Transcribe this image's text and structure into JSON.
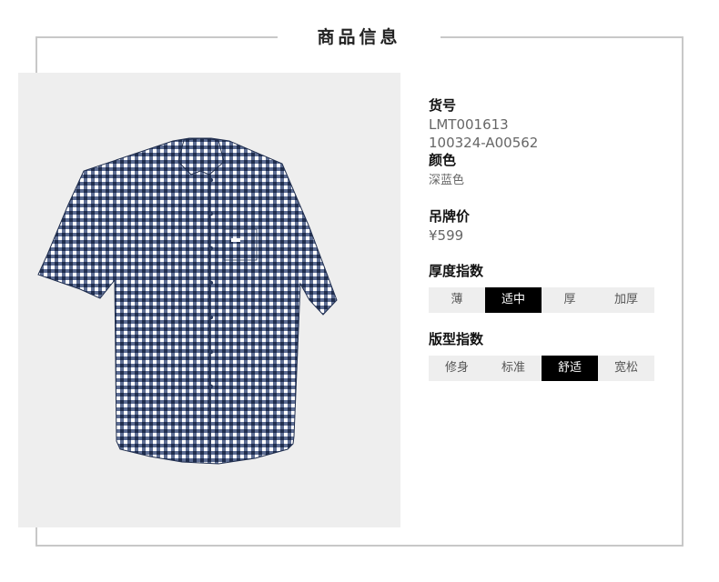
{
  "section_title": "商品信息",
  "product": {
    "sku_label": "货号",
    "sku_values": [
      "LMT001613",
      "100324-A00562"
    ],
    "color_label": "颜色",
    "color_value": "深蓝色",
    "price_label": "吊牌价",
    "price_value": "¥599",
    "thickness": {
      "label": "厚度指数",
      "options": [
        "薄",
        "适中",
        "厚",
        "加厚"
      ],
      "selected": "适中"
    },
    "fit": {
      "label": "版型指数",
      "options": [
        "修身",
        "标准",
        "舒适",
        "宽松"
      ],
      "selected": "舒适"
    }
  },
  "image": {
    "icon": "checked-short-sleeve-shirt-photo",
    "colors": {
      "navy": "#1f2d4d",
      "white": "#ffffff",
      "panel": "#eeeeee"
    }
  }
}
